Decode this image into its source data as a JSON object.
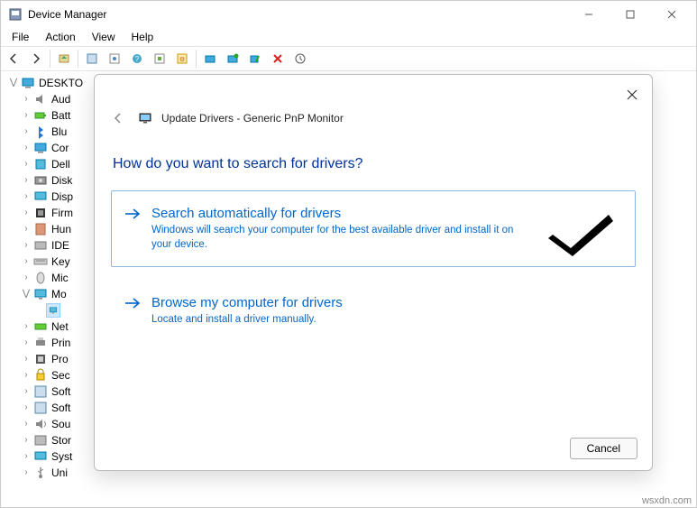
{
  "window": {
    "title": "Device Manager",
    "btn_min": "minimize",
    "btn_max": "maximize",
    "btn_close": "close"
  },
  "menu": {
    "file": "File",
    "action": "Action",
    "view": "View",
    "help": "Help"
  },
  "toolbar_icons": [
    "back",
    "forward",
    "up",
    "show-hidden",
    "properties",
    "help",
    "refresh",
    "scan",
    "update",
    "monitor",
    "uninstall",
    "remove",
    "legacy"
  ],
  "tree": {
    "root": "DESKTO",
    "items": [
      {
        "label": "Aud",
        "icon": "audio"
      },
      {
        "label": "Batt",
        "icon": "battery"
      },
      {
        "label": "Blu",
        "icon": "bluetooth"
      },
      {
        "label": "Cor",
        "icon": "computer"
      },
      {
        "label": "Dell",
        "icon": "firmware"
      },
      {
        "label": "Disk",
        "icon": "disk"
      },
      {
        "label": "Disp",
        "icon": "display"
      },
      {
        "label": "Firm",
        "icon": "chip"
      },
      {
        "label": "Hun",
        "icon": "hid"
      },
      {
        "label": "IDE",
        "icon": "ide"
      },
      {
        "label": "Key",
        "icon": "keyboard"
      },
      {
        "label": "Mic",
        "icon": "mouse"
      },
      {
        "label": "Mo",
        "icon": "monitor",
        "expanded": true,
        "selected_child": true
      },
      {
        "label": "Net",
        "icon": "network"
      },
      {
        "label": "Prin",
        "icon": "printer"
      },
      {
        "label": "Pro",
        "icon": "cpu"
      },
      {
        "label": "Sec",
        "icon": "security"
      },
      {
        "label": "Soft",
        "icon": "software"
      },
      {
        "label": "Soft",
        "icon": "software"
      },
      {
        "label": "Sou",
        "icon": "sound"
      },
      {
        "label": "Stor",
        "icon": "storage"
      },
      {
        "label": "Syst",
        "icon": "system"
      },
      {
        "label": "Uni",
        "icon": "usb"
      }
    ]
  },
  "dialog": {
    "title": "Update Drivers - Generic PnP Monitor",
    "heading": "How do you want to search for drivers?",
    "option1": {
      "title": "Search automatically for drivers",
      "desc": "Windows will search your computer for the best available driver and install it on your device."
    },
    "option2": {
      "title": "Browse my computer for drivers",
      "desc": "Locate and install a driver manually."
    },
    "cancel": "Cancel"
  },
  "watermark": "wsxdn.com"
}
